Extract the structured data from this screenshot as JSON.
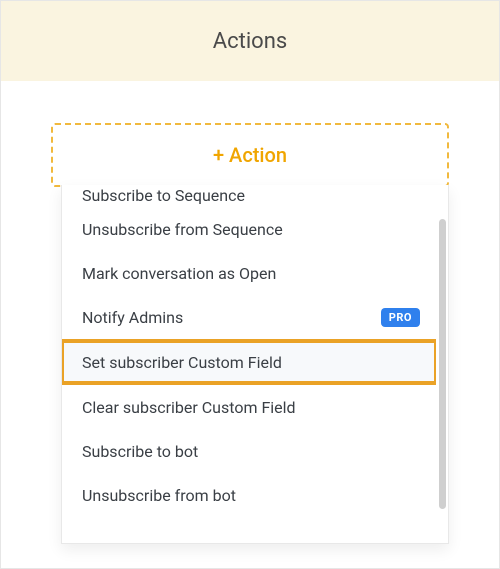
{
  "header": {
    "title": "Actions"
  },
  "add_button": {
    "label": "+ Action"
  },
  "menu": {
    "items": [
      {
        "label": "Subscribe to Sequence",
        "partial": true
      },
      {
        "label": "Unsubscribe from Sequence"
      },
      {
        "label": "Mark conversation as Open"
      },
      {
        "label": "Notify Admins",
        "badge": "PRO"
      },
      {
        "label": "Set subscriber Custom Field",
        "highlighted": true
      },
      {
        "label": "Clear subscriber Custom Field"
      },
      {
        "label": "Subscribe to bot"
      },
      {
        "label": "Unsubscribe from bot"
      }
    ]
  }
}
